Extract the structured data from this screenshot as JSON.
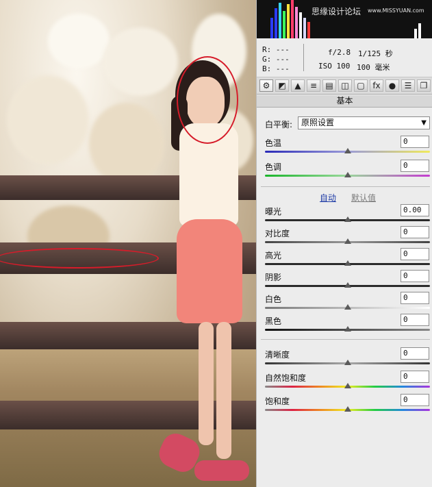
{
  "histogram": {
    "watermark": "思缘设计论坛",
    "watermark_url": "www.MISSYUAN.com"
  },
  "info": {
    "r_label": "R:",
    "r_value": "---",
    "g_label": "G:",
    "g_value": "---",
    "b_label": "B:",
    "b_value": "---",
    "aperture": "f/2.8",
    "shutter": "1/125 秒",
    "iso": "ISO 100",
    "focal": "100 毫米"
  },
  "toolbar": {
    "tools": [
      "camera-icon",
      "tone-curve-icon",
      "mountains-icon",
      "detail-icon",
      "hsl-icon",
      "split-toning-icon",
      "lens-icon",
      "fx-icon",
      "camera-calibration-icon",
      "presets-icon",
      "snapshots-icon"
    ],
    "glyphs": [
      "⚙",
      "◩",
      "▲",
      "≡",
      "▤",
      "◫",
      "▢",
      "fx",
      "●",
      "☰",
      "❐"
    ]
  },
  "section_title": "基本",
  "white_balance": {
    "label": "白平衡:",
    "value": "原照设置"
  },
  "sliders": [
    {
      "id": "temperature",
      "label": "色温",
      "value": "0",
      "position": 0.5
    },
    {
      "id": "tint",
      "label": "色调",
      "value": "0",
      "position": 0.5
    },
    {
      "id": "exposure",
      "label": "曝光",
      "value": "0.00",
      "position": 0.5
    },
    {
      "id": "contrast",
      "label": "对比度",
      "value": "0",
      "position": 0.5
    },
    {
      "id": "highlights",
      "label": "高光",
      "value": "0",
      "position": 0.5
    },
    {
      "id": "shadows",
      "label": "阴影",
      "value": "0",
      "position": 0.5
    },
    {
      "id": "whites",
      "label": "白色",
      "value": "0",
      "position": 0.5
    },
    {
      "id": "blacks",
      "label": "黑色",
      "value": "0",
      "position": 0.5
    },
    {
      "id": "clarity",
      "label": "清晰度",
      "value": "0",
      "position": 0.5
    },
    {
      "id": "vibrance",
      "label": "自然饱和度",
      "value": "0",
      "position": 0.5
    },
    {
      "id": "saturation",
      "label": "饱和度",
      "value": "0",
      "position": 0.5
    }
  ],
  "tone": {
    "auto": "自动",
    "default": "默认值"
  },
  "colors": {
    "accent_link": "#1f3ca6",
    "annotation": "#d61c2a"
  }
}
